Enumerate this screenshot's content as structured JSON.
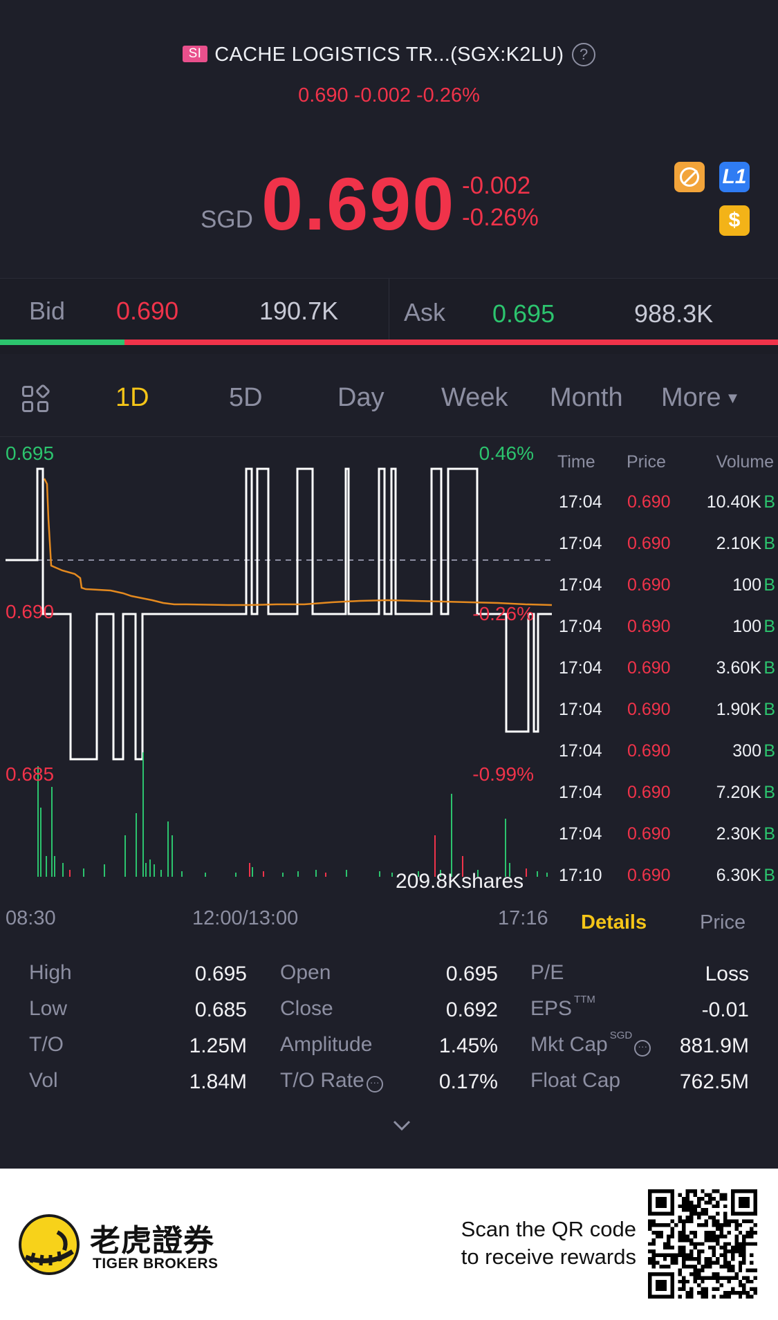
{
  "header": {
    "badge": "SI",
    "title": "CACHE LOGISTICS TR...(SGX:K2LU)",
    "help_icon": "question-circle-icon",
    "subtitle": "0.690 -0.002 -0.26%",
    "currency": "SGD",
    "price": "0.690",
    "change": "-0.002",
    "change_pct": "-0.26%",
    "icons": [
      "hk-connect-icon",
      "level1-icon",
      "dollar-icon"
    ],
    "l1_label": "L1",
    "usd_label": "$"
  },
  "bidask": {
    "bid_label": "Bid",
    "bid_price": "0.690",
    "bid_size": "190.7K",
    "ask_label": "Ask",
    "ask_price": "0.695",
    "ask_size": "988.3K",
    "bid_ratio": 0.16
  },
  "tabs": [
    "1D",
    "5D",
    "Day",
    "Week",
    "Month",
    "More"
  ],
  "chart": {
    "y_top": "0.695",
    "y_mid": "0.690",
    "y_bot": "0.685",
    "pct_top": "0.46%",
    "pct_mid": "-0.26%",
    "pct_bot": "-0.99%",
    "volume_label": "209.8Kshares",
    "x_labels": [
      "08:30",
      "12:00/13:00",
      "17:16"
    ]
  },
  "ticks": {
    "headers": {
      "time": "Time",
      "price": "Price",
      "volume": "Volume"
    },
    "rows": [
      {
        "time": "17:04",
        "price": "0.690",
        "volume": "10.40K",
        "side": "B"
      },
      {
        "time": "17:04",
        "price": "0.690",
        "volume": "2.10K",
        "side": "B"
      },
      {
        "time": "17:04",
        "price": "0.690",
        "volume": "100",
        "side": "B"
      },
      {
        "time": "17:04",
        "price": "0.690",
        "volume": "100",
        "side": "B"
      },
      {
        "time": "17:04",
        "price": "0.690",
        "volume": "3.60K",
        "side": "B"
      },
      {
        "time": "17:04",
        "price": "0.690",
        "volume": "1.90K",
        "side": "B"
      },
      {
        "time": "17:04",
        "price": "0.690",
        "volume": "300",
        "side": "B"
      },
      {
        "time": "17:04",
        "price": "0.690",
        "volume": "7.20K",
        "side": "B"
      },
      {
        "time": "17:04",
        "price": "0.690",
        "volume": "2.30K",
        "side": "B"
      },
      {
        "time": "17:10",
        "price": "0.690",
        "volume": "6.30K",
        "side": "B"
      }
    ]
  },
  "detail_tabs": {
    "details": "Details",
    "price": "Price"
  },
  "stats": {
    "col1": [
      {
        "label": "High",
        "value": "0.695"
      },
      {
        "label": "Low",
        "value": "0.685"
      },
      {
        "label": "T/O",
        "value": "1.25M"
      },
      {
        "label": "Vol",
        "value": "1.84M"
      }
    ],
    "col2": [
      {
        "label": "Open",
        "value": "0.695"
      },
      {
        "label": "Close",
        "value": "0.692"
      },
      {
        "label": "Amplitude",
        "value": "1.45%"
      },
      {
        "label": "T/O Rate",
        "value": "0.17%"
      }
    ],
    "col3": [
      {
        "label": "P/E",
        "value": "Loss"
      },
      {
        "label": "EPS",
        "value": "-0.01"
      },
      {
        "label": "Mkt Cap",
        "value": "881.9M"
      },
      {
        "label": "Float Cap",
        "value": "762.5M"
      }
    ],
    "eps_sup": "TTM",
    "mktcap_sup": "SGD"
  },
  "footer": {
    "brand_cn": "老虎證券",
    "brand_en": "TIGER BROKERS",
    "scan_line1": "Scan the QR code",
    "scan_line2": "to receive rewards"
  },
  "colors": {
    "up": "#2cc46e",
    "down": "#f0334a",
    "accent": "#f5c518",
    "avg_line": "#e58a1f",
    "bg": "#1e1f29"
  }
}
